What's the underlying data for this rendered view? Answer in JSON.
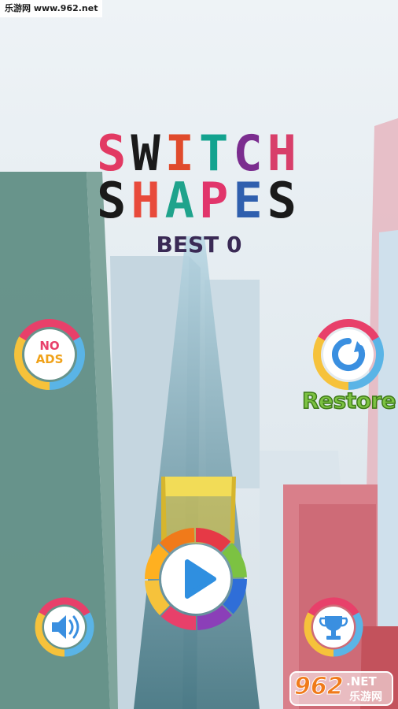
{
  "watermark": {
    "text": "乐游网 www.962.net"
  },
  "title": {
    "line1": [
      "S",
      "W",
      "I",
      "T",
      "C",
      "H"
    ],
    "line2": [
      "S",
      "H",
      "A",
      "P",
      "E",
      "S"
    ],
    "colors1": [
      "#e23a63",
      "#1a1a1a",
      "#e04b2c",
      "#13a38f",
      "#7b2d8f",
      "#d83f6a"
    ],
    "colors2": [
      "#1a1a1a",
      "#e84a3b",
      "#1fa38c",
      "#e1356b",
      "#2f5fae",
      "#1a1a1a"
    ]
  },
  "best": {
    "label": "BEST 0"
  },
  "no_ads": {
    "line1": "NO",
    "line2": "ADS"
  },
  "restore": {
    "label": "Restore"
  },
  "logo": {
    "main": "962",
    "dot_net": ".NET",
    "sub": "乐游网"
  },
  "ring_colors": [
    "#e8406a",
    "#5ab4e6",
    "#f6c23b",
    "#f6c23b",
    "#e8406a",
    "#5ab4e6"
  ],
  "play_ring_colors": [
    "#e63946",
    "#7cc242",
    "#2f6ed8",
    "#8b3fb8",
    "#e8406a",
    "#f6c23b",
    "#ffb020",
    "#f07a1a"
  ],
  "accent": {
    "play_blue": "#2f8fe0",
    "icon_blue": "#3a8fe0"
  }
}
